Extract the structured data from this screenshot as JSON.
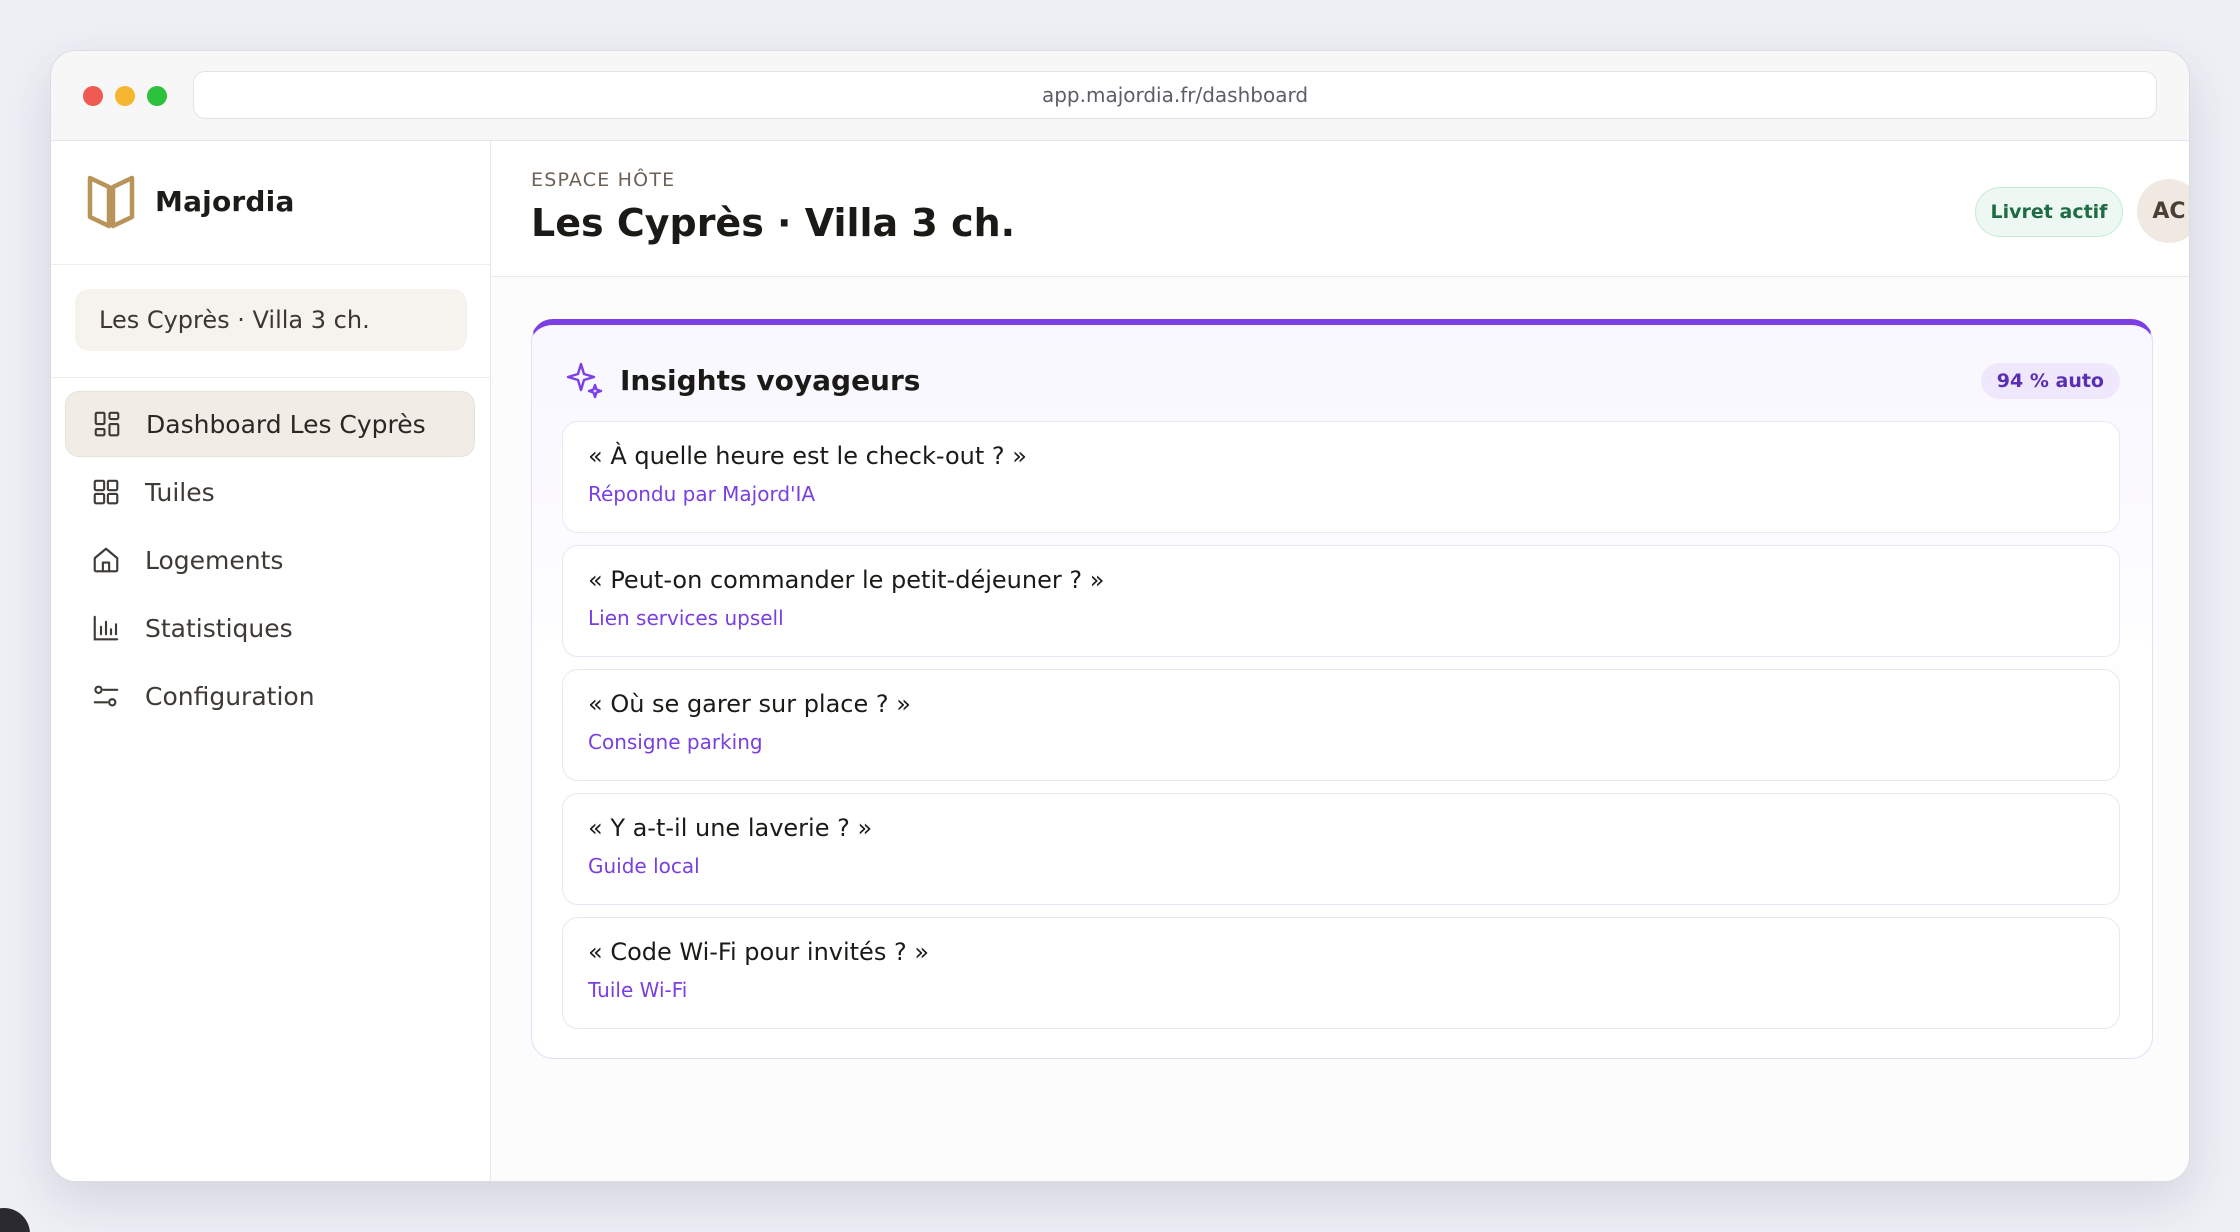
{
  "browser": {
    "url": "app.majordia.fr/dashboard"
  },
  "sidebar": {
    "brand_name": "Majordia",
    "property_selector": "Les Cyprès · Villa 3 ch.",
    "items": [
      {
        "label": "Dashboard Les Cyprès",
        "icon": "dashboard-icon",
        "active": true
      },
      {
        "label": "Tuiles",
        "icon": "grid-icon",
        "active": false
      },
      {
        "label": "Logements",
        "icon": "home-icon",
        "active": false
      },
      {
        "label": "Statistiques",
        "icon": "bar-chart-icon",
        "active": false
      },
      {
        "label": "Configuration",
        "icon": "sliders-icon",
        "active": false
      }
    ]
  },
  "header": {
    "eyebrow": "ESPACE HÔTE",
    "title": "Les Cyprès · Villa 3 ch.",
    "status_badge": "Livret actif",
    "avatar_initials": "AC"
  },
  "insights": {
    "title": "Insights voyageurs",
    "icon": "sparkles-icon",
    "auto_badge": "94 % auto",
    "questions": [
      {
        "question": "« À quelle heure est le check-out ? »",
        "answer": "Répondu par Majord'IA"
      },
      {
        "question": "« Peut-on commander le petit-déjeuner ? »",
        "answer": "Lien services upsell"
      },
      {
        "question": "« Où se garer sur place ? »",
        "answer": "Consigne parking"
      },
      {
        "question": "« Y a-t-il une laverie ? »",
        "answer": "Guide local"
      },
      {
        "question": "« Code Wi-Fi pour invités ? »",
        "answer": "Tuile Wi-Fi"
      }
    ]
  },
  "colors": {
    "accent": "#7b3fe4",
    "brand": "#b8935a",
    "success": "#1f6b43"
  }
}
